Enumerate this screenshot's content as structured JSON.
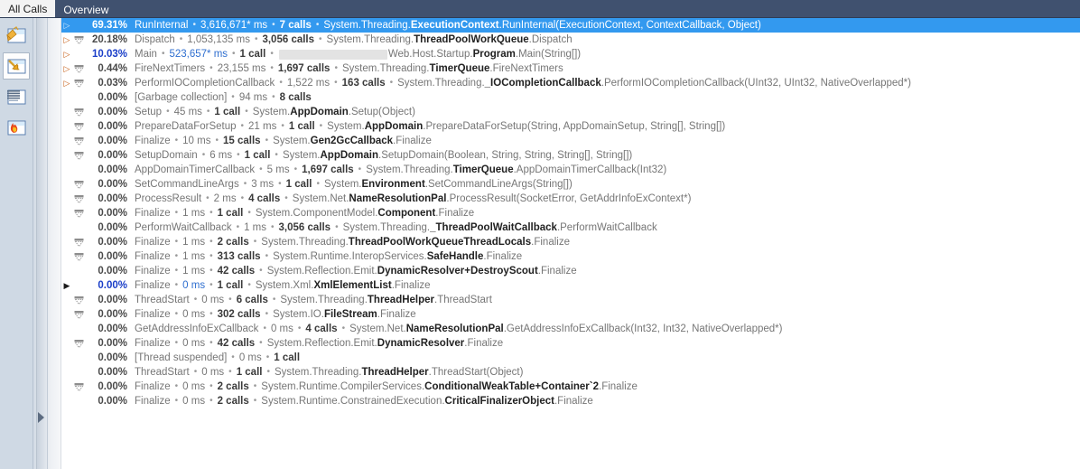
{
  "tabs": [
    {
      "label": "All Calls",
      "active": true
    },
    {
      "label": "Overview",
      "active": false
    }
  ],
  "rail": {
    "items": [
      {
        "name": "call-tree-icon",
        "label": "Call tree",
        "selected": false
      },
      {
        "name": "callers-callees-icon",
        "label": "Callers and callees",
        "selected": true
      },
      {
        "name": "flat-list-icon",
        "label": "Flat list",
        "selected": false
      },
      {
        "name": "hot-spots-icon",
        "label": "Hot spots",
        "selected": false
      }
    ]
  },
  "splitter": {
    "expand_label": "Expand panel"
  },
  "colors": {
    "selection": "#3399ef",
    "tabstrip": "#40516f",
    "rail": "#cfd9e4",
    "expander": "#c55a11",
    "pct_blue": "#1a3ec8",
    "value_blue": "#2f6fd0"
  },
  "list": {
    "rows": [
      {
        "expander": "hollow",
        "funnel": false,
        "selected": true,
        "pct": "69.31%",
        "pct_blue": false,
        "name": "RunInternal",
        "time": "3,616,671* ms",
        "time_blue": false,
        "calls": "7 calls",
        "sig_pre": "System.Threading.",
        "sig_type": "ExecutionContext",
        "sig_post": ".RunInternal(ExecutionContext, ContextCallback, Object)"
      },
      {
        "expander": "hollow",
        "funnel": true,
        "selected": false,
        "pct": "20.18%",
        "pct_blue": false,
        "name": "Dispatch",
        "time": "1,053,135 ms",
        "time_blue": false,
        "calls": "3,056 calls",
        "sig_pre": "System.Threading.",
        "sig_type": "ThreadPoolWorkQueue",
        "sig_post": ".Dispatch"
      },
      {
        "expander": "hollow",
        "funnel": false,
        "selected": false,
        "pct": "10.03%",
        "pct_blue": true,
        "name": "Main",
        "time": "523,657* ms",
        "time_blue": true,
        "calls": "1 call",
        "redacted": true,
        "sig_pre": "Web.Host.Startup.",
        "sig_type": "Program",
        "sig_post": ".Main(String[])"
      },
      {
        "expander": "hollow",
        "funnel": true,
        "selected": false,
        "pct": "0.44%",
        "pct_blue": false,
        "name": "FireNextTimers",
        "time": "23,155 ms",
        "time_blue": false,
        "calls": "1,697 calls",
        "sig_pre": "System.Threading.",
        "sig_type": "TimerQueue",
        "sig_post": ".FireNextTimers"
      },
      {
        "expander": "hollow",
        "funnel": true,
        "selected": false,
        "pct": "0.03%",
        "pct_blue": false,
        "name": "PerformIOCompletionCallback",
        "time": "1,522 ms",
        "time_blue": false,
        "calls": "163 calls",
        "sig_pre": "System.Threading.",
        "sig_type": "_IOCompletionCallback",
        "sig_post": ".PerformIOCompletionCallback(UInt32, UInt32, NativeOverlapped*)"
      },
      {
        "expander": "none",
        "funnel": false,
        "selected": false,
        "pct": "0.00%",
        "pct_blue": false,
        "name": "[Garbage collection]",
        "time": "94 ms",
        "time_blue": false,
        "calls": "8 calls",
        "sig_pre": "",
        "sig_type": "",
        "sig_post": ""
      },
      {
        "expander": "none",
        "funnel": true,
        "selected": false,
        "pct": "0.00%",
        "pct_blue": false,
        "name": "Setup",
        "time": "45 ms",
        "time_blue": false,
        "calls": "1 call",
        "sig_pre": "System.",
        "sig_type": "AppDomain",
        "sig_post": ".Setup(Object)"
      },
      {
        "expander": "none",
        "funnel": true,
        "selected": false,
        "pct": "0.00%",
        "pct_blue": false,
        "name": "PrepareDataForSetup",
        "time": "21 ms",
        "time_blue": false,
        "calls": "1 call",
        "sig_pre": "System.",
        "sig_type": "AppDomain",
        "sig_post": ".PrepareDataForSetup(String, AppDomainSetup, String[], String[])"
      },
      {
        "expander": "none",
        "funnel": true,
        "selected": false,
        "pct": "0.00%",
        "pct_blue": false,
        "name": "Finalize",
        "time": "10 ms",
        "time_blue": false,
        "calls": "15 calls",
        "sig_pre": "System.",
        "sig_type": "Gen2GcCallback",
        "sig_post": ".Finalize"
      },
      {
        "expander": "none",
        "funnel": true,
        "selected": false,
        "pct": "0.00%",
        "pct_blue": false,
        "name": "SetupDomain",
        "time": "6 ms",
        "time_blue": false,
        "calls": "1 call",
        "sig_pre": "System.",
        "sig_type": "AppDomain",
        "sig_post": ".SetupDomain(Boolean, String, String, String[], String[])"
      },
      {
        "expander": "none",
        "funnel": false,
        "selected": false,
        "pct": "0.00%",
        "pct_blue": false,
        "name": "AppDomainTimerCallback",
        "time": "5 ms",
        "time_blue": false,
        "calls": "1,697 calls",
        "sig_pre": "System.Threading.",
        "sig_type": "TimerQueue",
        "sig_post": ".AppDomainTimerCallback(Int32)"
      },
      {
        "expander": "none",
        "funnel": true,
        "selected": false,
        "pct": "0.00%",
        "pct_blue": false,
        "name": "SetCommandLineArgs",
        "time": "3 ms",
        "time_blue": false,
        "calls": "1 call",
        "sig_pre": "System.",
        "sig_type": "Environment",
        "sig_post": ".SetCommandLineArgs(String[])"
      },
      {
        "expander": "none",
        "funnel": true,
        "selected": false,
        "pct": "0.00%",
        "pct_blue": false,
        "name": "ProcessResult",
        "time": "2 ms",
        "time_blue": false,
        "calls": "4 calls",
        "sig_pre": "System.Net.",
        "sig_type": "NameResolutionPal",
        "sig_post": ".ProcessResult(SocketError, GetAddrInfoExContext*)"
      },
      {
        "expander": "none",
        "funnel": true,
        "selected": false,
        "pct": "0.00%",
        "pct_blue": false,
        "name": "Finalize",
        "time": "1 ms",
        "time_blue": false,
        "calls": "1 call",
        "sig_pre": "System.ComponentModel.",
        "sig_type": "Component",
        "sig_post": ".Finalize"
      },
      {
        "expander": "none",
        "funnel": false,
        "selected": false,
        "pct": "0.00%",
        "pct_blue": false,
        "name": "PerformWaitCallback",
        "time": "1 ms",
        "time_blue": false,
        "calls": "3,056 calls",
        "sig_pre": "System.Threading.",
        "sig_type": "_ThreadPoolWaitCallback",
        "sig_post": ".PerformWaitCallback"
      },
      {
        "expander": "none",
        "funnel": true,
        "selected": false,
        "pct": "0.00%",
        "pct_blue": false,
        "name": "Finalize",
        "time": "1 ms",
        "time_blue": false,
        "calls": "2 calls",
        "sig_pre": "System.Threading.",
        "sig_type": "ThreadPoolWorkQueueThreadLocals",
        "sig_post": ".Finalize"
      },
      {
        "expander": "none",
        "funnel": true,
        "selected": false,
        "pct": "0.00%",
        "pct_blue": false,
        "name": "Finalize",
        "time": "1 ms",
        "time_blue": false,
        "calls": "313 calls",
        "sig_pre": "System.Runtime.InteropServices.",
        "sig_type": "SafeHandle",
        "sig_post": ".Finalize"
      },
      {
        "expander": "none",
        "funnel": false,
        "selected": false,
        "pct": "0.00%",
        "pct_blue": false,
        "name": "Finalize",
        "time": "1 ms",
        "time_blue": false,
        "calls": "42 calls",
        "sig_pre": "System.Reflection.Emit.",
        "sig_type": "DynamicResolver+DestroyScout",
        "sig_post": ".Finalize"
      },
      {
        "expander": "filled",
        "funnel": false,
        "selected": false,
        "pct": "0.00%",
        "pct_blue": true,
        "name": "Finalize",
        "time": "0 ms",
        "time_blue": true,
        "calls": "1 call",
        "sig_pre": "System.Xml.",
        "sig_type": "XmlElementList",
        "sig_post": ".Finalize"
      },
      {
        "expander": "none",
        "funnel": true,
        "selected": false,
        "pct": "0.00%",
        "pct_blue": false,
        "name": "ThreadStart",
        "time": "0 ms",
        "time_blue": false,
        "calls": "6 calls",
        "sig_pre": "System.Threading.",
        "sig_type": "ThreadHelper",
        "sig_post": ".ThreadStart"
      },
      {
        "expander": "none",
        "funnel": true,
        "selected": false,
        "pct": "0.00%",
        "pct_blue": false,
        "name": "Finalize",
        "time": "0 ms",
        "time_blue": false,
        "calls": "302 calls",
        "sig_pre": "System.IO.",
        "sig_type": "FileStream",
        "sig_post": ".Finalize"
      },
      {
        "expander": "none",
        "funnel": false,
        "selected": false,
        "pct": "0.00%",
        "pct_blue": false,
        "name": "GetAddressInfoExCallback",
        "time": "0 ms",
        "time_blue": false,
        "calls": "4 calls",
        "sig_pre": "System.Net.",
        "sig_type": "NameResolutionPal",
        "sig_post": ".GetAddressInfoExCallback(Int32, Int32, NativeOverlapped*)"
      },
      {
        "expander": "none",
        "funnel": true,
        "selected": false,
        "pct": "0.00%",
        "pct_blue": false,
        "name": "Finalize",
        "time": "0 ms",
        "time_blue": false,
        "calls": "42 calls",
        "sig_pre": "System.Reflection.Emit.",
        "sig_type": "DynamicResolver",
        "sig_post": ".Finalize"
      },
      {
        "expander": "none",
        "funnel": false,
        "selected": false,
        "pct": "0.00%",
        "pct_blue": false,
        "name": "[Thread suspended]",
        "time": "0 ms",
        "time_blue": false,
        "calls": "1 call",
        "sig_pre": "",
        "sig_type": "",
        "sig_post": ""
      },
      {
        "expander": "none",
        "funnel": false,
        "selected": false,
        "pct": "0.00%",
        "pct_blue": false,
        "name": "ThreadStart",
        "time": "0 ms",
        "time_blue": false,
        "calls": "1 call",
        "sig_pre": "System.Threading.",
        "sig_type": "ThreadHelper",
        "sig_post": ".ThreadStart(Object)"
      },
      {
        "expander": "none",
        "funnel": true,
        "selected": false,
        "pct": "0.00%",
        "pct_blue": false,
        "name": "Finalize",
        "time": "0 ms",
        "time_blue": false,
        "calls": "2 calls",
        "sig_pre": "System.Runtime.CompilerServices.",
        "sig_type": "ConditionalWeakTable+Container`2",
        "sig_post": ".Finalize"
      },
      {
        "expander": "none",
        "funnel": false,
        "selected": false,
        "pct": "0.00%",
        "pct_blue": false,
        "name": "Finalize",
        "time": "0 ms",
        "time_blue": false,
        "calls": "2 calls",
        "sig_pre": "System.Runtime.ConstrainedExecution.",
        "sig_type": "CriticalFinalizerObject",
        "sig_post": ".Finalize"
      }
    ]
  }
}
